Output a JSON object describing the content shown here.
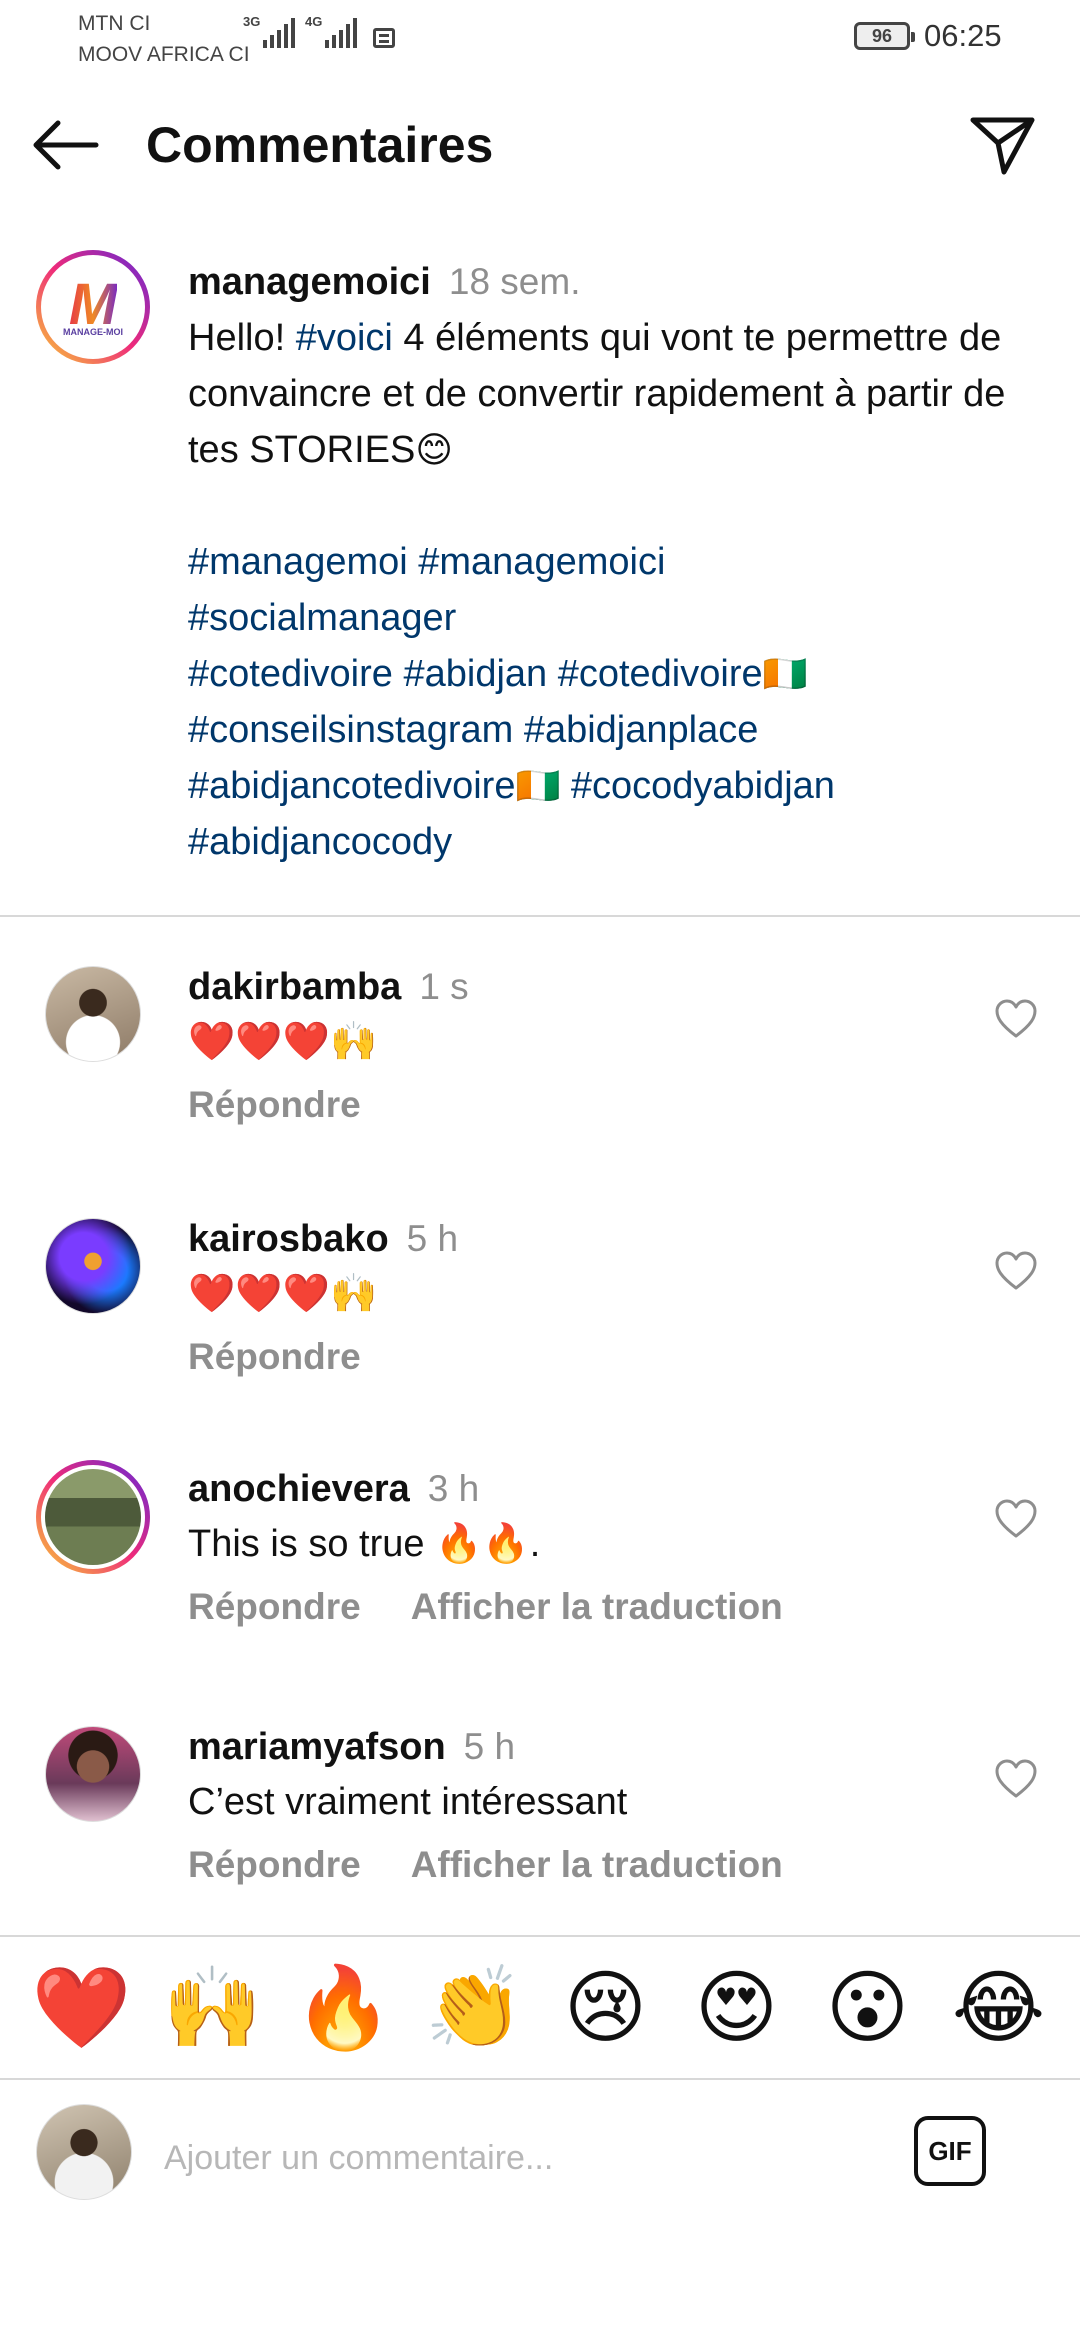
{
  "status_bar": {
    "carrier_1": "MTN CI",
    "carrier_2": "MOOV AFRICA CI",
    "network_1": "3G",
    "network_2": "4G",
    "battery": "96",
    "time": "06:25"
  },
  "header": {
    "title": "Commentaires",
    "back_icon": "arrow-left-icon",
    "send_icon": "paper-plane-icon"
  },
  "caption": {
    "username": "managemoici",
    "time": "18 sem.",
    "text_line1_pre": "Hello! ",
    "text_line1_tag": "#voici",
    "text_line1_post": " 4 éléments qui vont te permettre de convaincre et de convertir rapidement à partir de tes STORIES",
    "text_emoji": "😊",
    "hashtags": {
      "h1": "#managemoi",
      "h2": "#managemoici",
      "h3": "#socialmanager",
      "h4": "#cotedivoire",
      "h5": "#abidjan",
      "h6": "#cotedivoire",
      "flag": "🇨🇮",
      "h7": "#conseilsinstagram",
      "h8": "#abidjanplace",
      "h9": "#abidjancotedivoire",
      "h10": "#cocodyabidjan",
      "h11": "#abidjancocody"
    },
    "logo_text": "MANAGE-MOI"
  },
  "comments": [
    {
      "username": "dakirbamba",
      "time": "1 s",
      "text": "❤️❤️❤️🙌",
      "reply": "Répondre",
      "translate": ""
    },
    {
      "username": "kairosbako",
      "time": "5 h",
      "text": "❤️❤️❤️🙌",
      "reply": "Répondre",
      "translate": ""
    },
    {
      "username": "anochievera",
      "time": "3 h",
      "text": "This is so true 🔥🔥.",
      "reply": "Répondre",
      "translate": "Afficher la traduction"
    },
    {
      "username": "mariamyafson",
      "time": "5 h",
      "text": "C’est vraiment intéressant",
      "reply": "Répondre",
      "translate": "Afficher la traduction"
    }
  ],
  "emoji_bar": [
    "❤️",
    "🙌",
    "🔥",
    "👏",
    "😢",
    "😍",
    "😮",
    "😂"
  ],
  "composer": {
    "placeholder": "Ajouter un commentaire...",
    "gif_label": "GIF"
  },
  "colors": {
    "hashtag": "#00376b",
    "muted": "#8e8e8e",
    "story_ring": [
      "#f9ce34",
      "#ee2a7b",
      "#6228d7"
    ]
  }
}
